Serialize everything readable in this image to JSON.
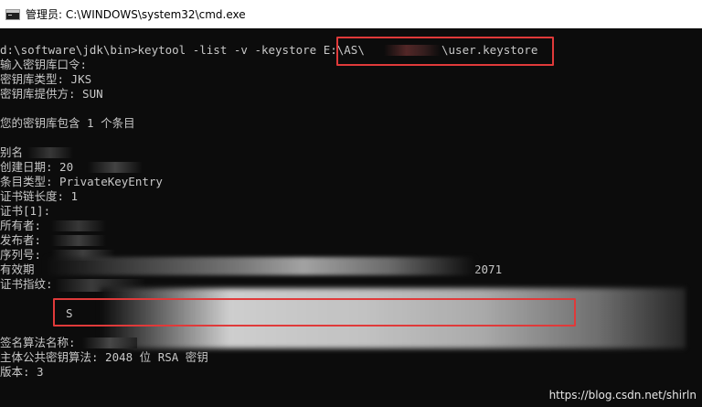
{
  "window": {
    "title": "管理员: C:\\WINDOWS\\system32\\cmd.exe",
    "icon": "cmd-console-icon"
  },
  "console": {
    "lines": [
      "d:\\software\\jdk\\bin>keytool -list -v -keystore E:\\AS\\",
      "输入密钥库口令:",
      "密钥库类型: JKS",
      "密钥库提供方: SUN",
      "",
      "您的密钥库包含 1 个条目",
      "",
      "别名",
      "创建日期: 20",
      "条目类型: PrivateKeyEntry",
      "证书链长度: 1",
      "证书[1]:",
      "所有者:",
      "发布者:",
      "序列号:",
      "有效期",
      "证书指纹:",
      "",
      "",
      "",
      "签名算法名称:",
      "主体公共密钥算法: 2048 位 RSA 密钥",
      "版本: 3"
    ],
    "command_tail": "\\user.keystore",
    "expiry_tail": "2071",
    "fingerprint_prefix": "S"
  },
  "watermark": "https://blog.csdn.net/shirln"
}
